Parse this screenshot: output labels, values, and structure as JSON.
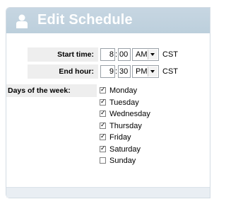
{
  "panel": {
    "title": "Edit Schedule",
    "icon": "user-icon"
  },
  "start_time": {
    "label": "Start time:",
    "hour": "8",
    "minute": "00",
    "ampm": "AM",
    "tz": "CST"
  },
  "end_hour": {
    "label": "End hour:",
    "hour": "9",
    "minute": "30",
    "ampm": "PM",
    "tz": "CST"
  },
  "days": {
    "label": "Days of the week:",
    "items": [
      {
        "label": "Monday",
        "checked": true
      },
      {
        "label": "Tuesday",
        "checked": true
      },
      {
        "label": "Wednesday",
        "checked": true
      },
      {
        "label": "Thursday",
        "checked": true
      },
      {
        "label": "Friday",
        "checked": true
      },
      {
        "label": "Saturday",
        "checked": true
      },
      {
        "label": "Sunday",
        "checked": false
      }
    ]
  },
  "colors": {
    "header": "#c7d6e2",
    "label_bg": "#eeeeee",
    "border": "#d3dce4"
  }
}
